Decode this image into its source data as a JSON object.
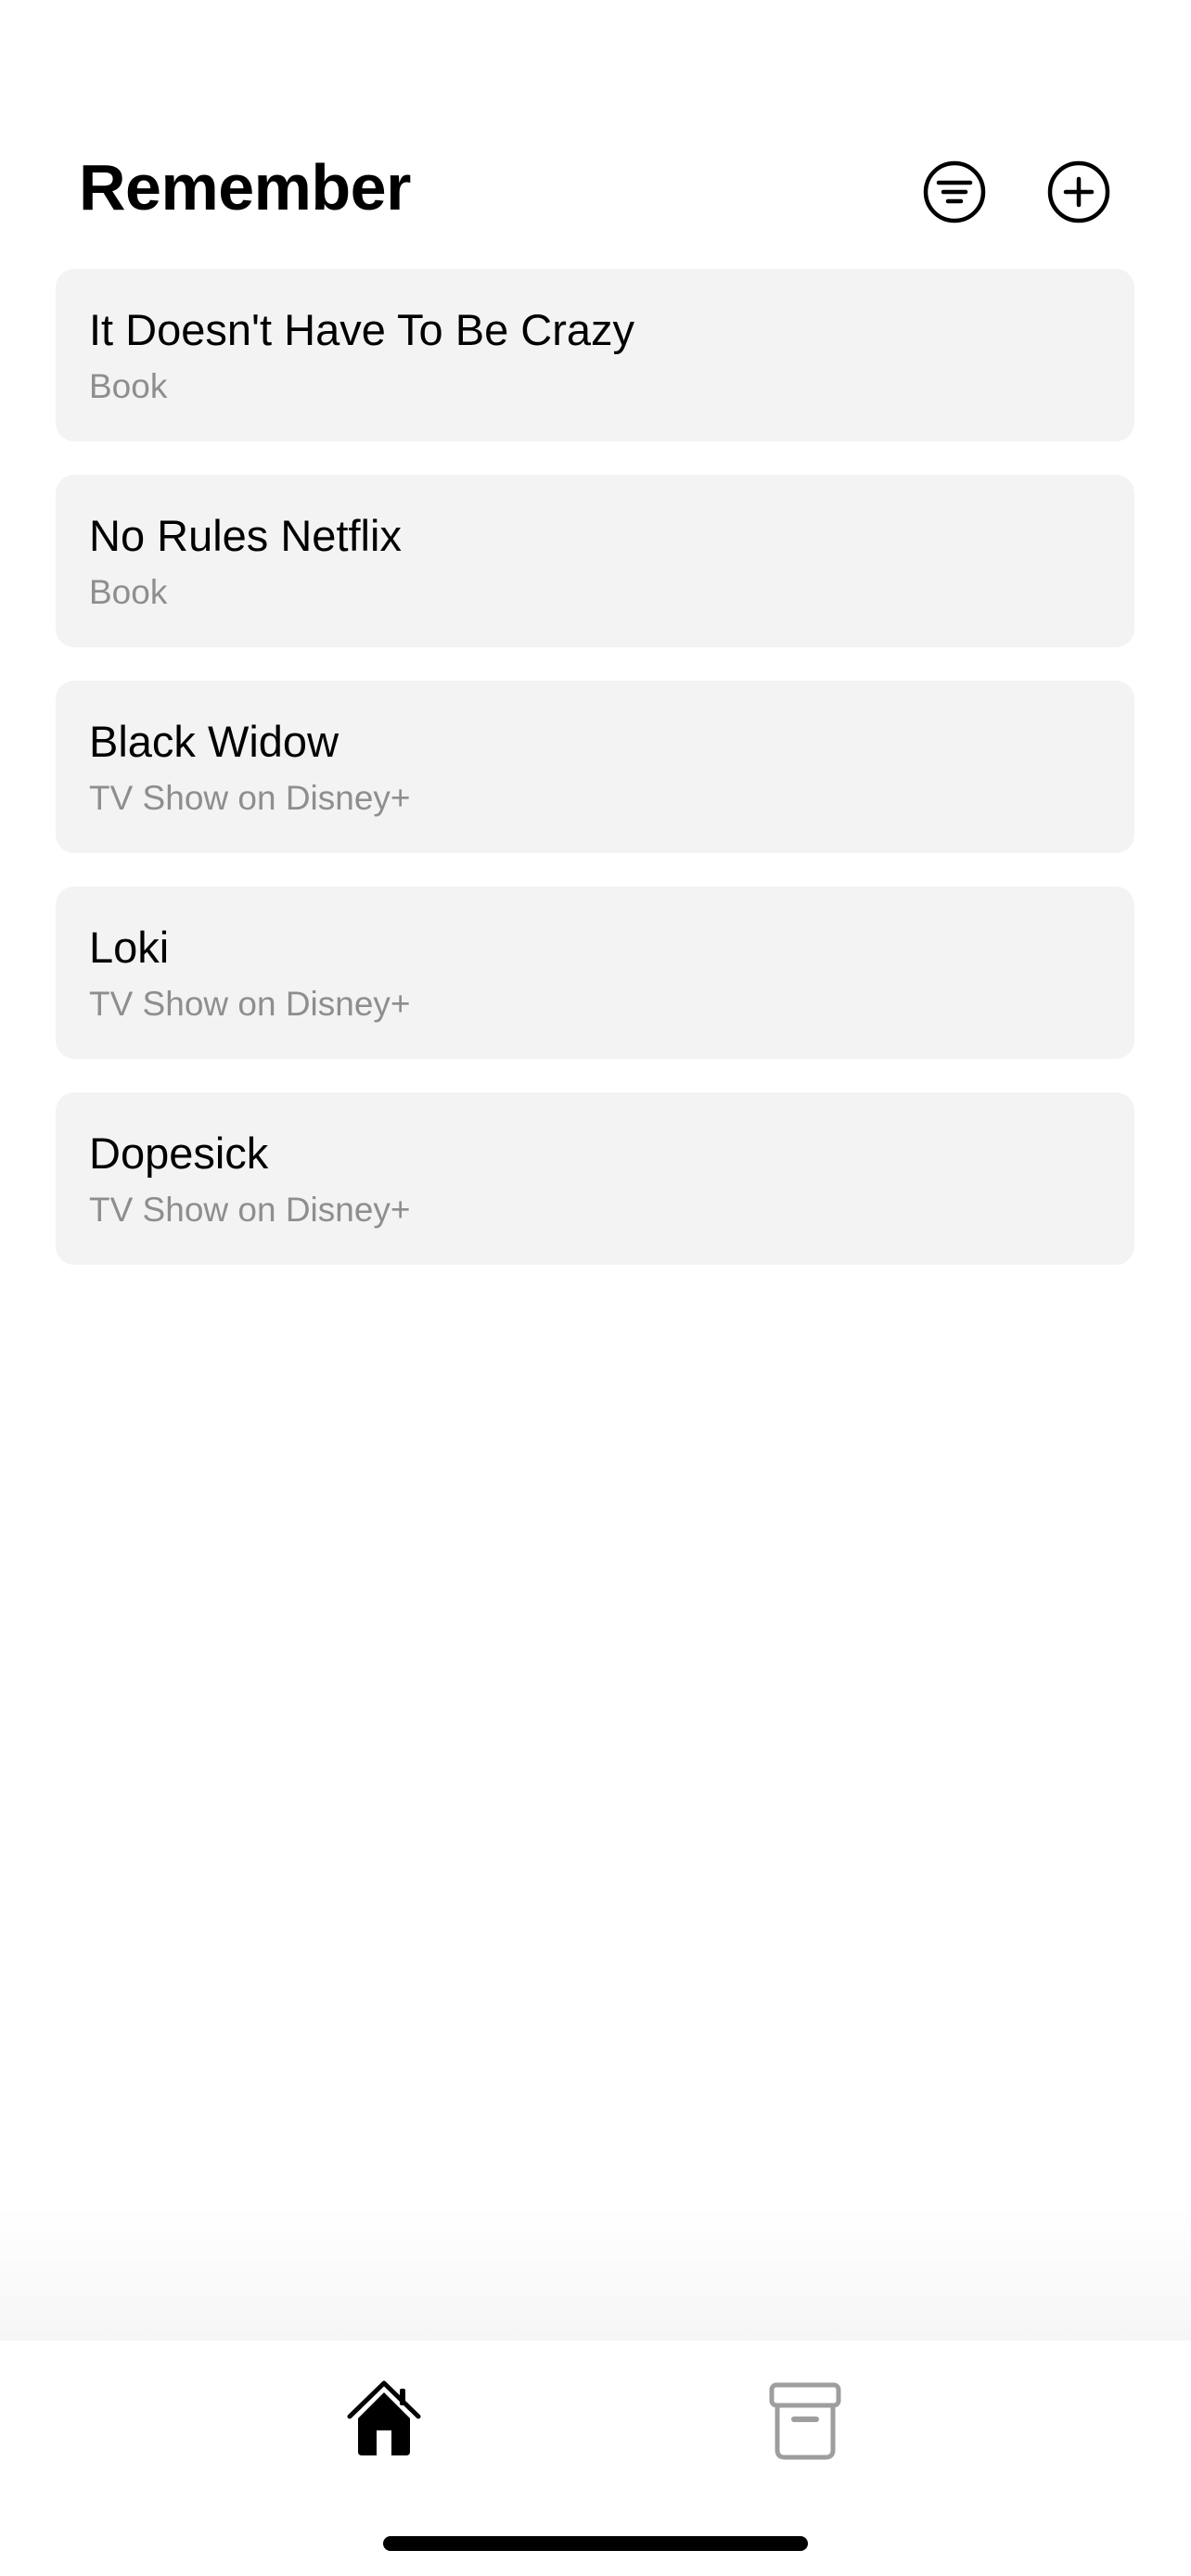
{
  "header": {
    "title": "Remember",
    "filter_icon": "filter-circle-icon",
    "add_icon": "plus-circle-icon"
  },
  "items": [
    {
      "title": "It Doesn't Have To Be Crazy",
      "subtitle": "Book"
    },
    {
      "title": "No Rules Netflix",
      "subtitle": "Book"
    },
    {
      "title": "Black Widow",
      "subtitle": "TV Show on Disney+"
    },
    {
      "title": "Loki",
      "subtitle": "TV Show on Disney+"
    },
    {
      "title": "Dopesick",
      "subtitle": "TV Show on Disney+"
    }
  ],
  "tabbar": {
    "tabs": [
      {
        "icon": "home-icon",
        "active": true
      },
      {
        "icon": "archive-icon",
        "active": false
      }
    ],
    "colors": {
      "active": "#000000",
      "inactive": "#9e9e9e"
    }
  },
  "colors": {
    "card_bg": "#f3f3f3",
    "subtitle": "#8e8e8e"
  }
}
